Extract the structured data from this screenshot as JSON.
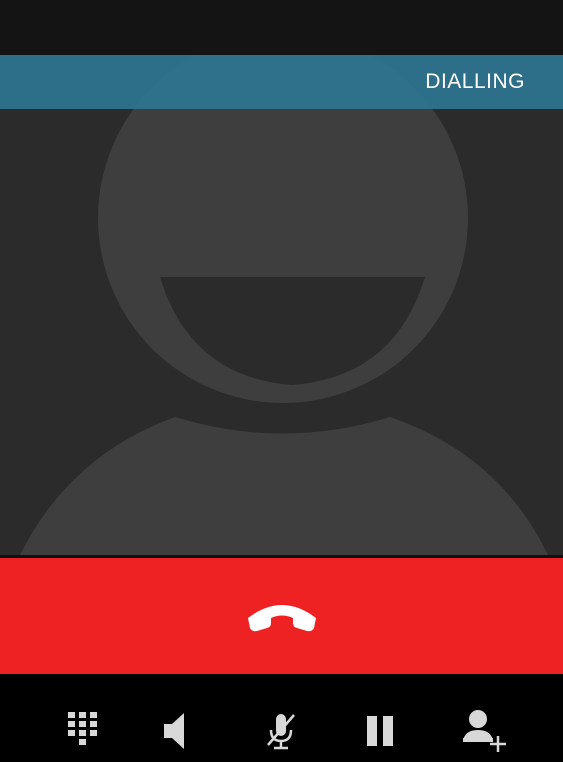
{
  "call": {
    "status": "DIALLING"
  },
  "colors": {
    "status_banner": "#2e7896",
    "end_call": "#ee2222",
    "photo_background": "#2b2b2b",
    "avatar_silhouette": "#3e3e3e",
    "icon": "#d8d8d8"
  },
  "controls": [
    {
      "name": "dialpad",
      "icon": "dialpad-icon"
    },
    {
      "name": "speaker",
      "icon": "speaker-icon"
    },
    {
      "name": "mute",
      "icon": "mute-microphone-icon"
    },
    {
      "name": "hold",
      "icon": "pause-icon"
    },
    {
      "name": "add-call",
      "icon": "add-person-icon"
    }
  ],
  "end_call_icon": "hang-up-handset-icon"
}
